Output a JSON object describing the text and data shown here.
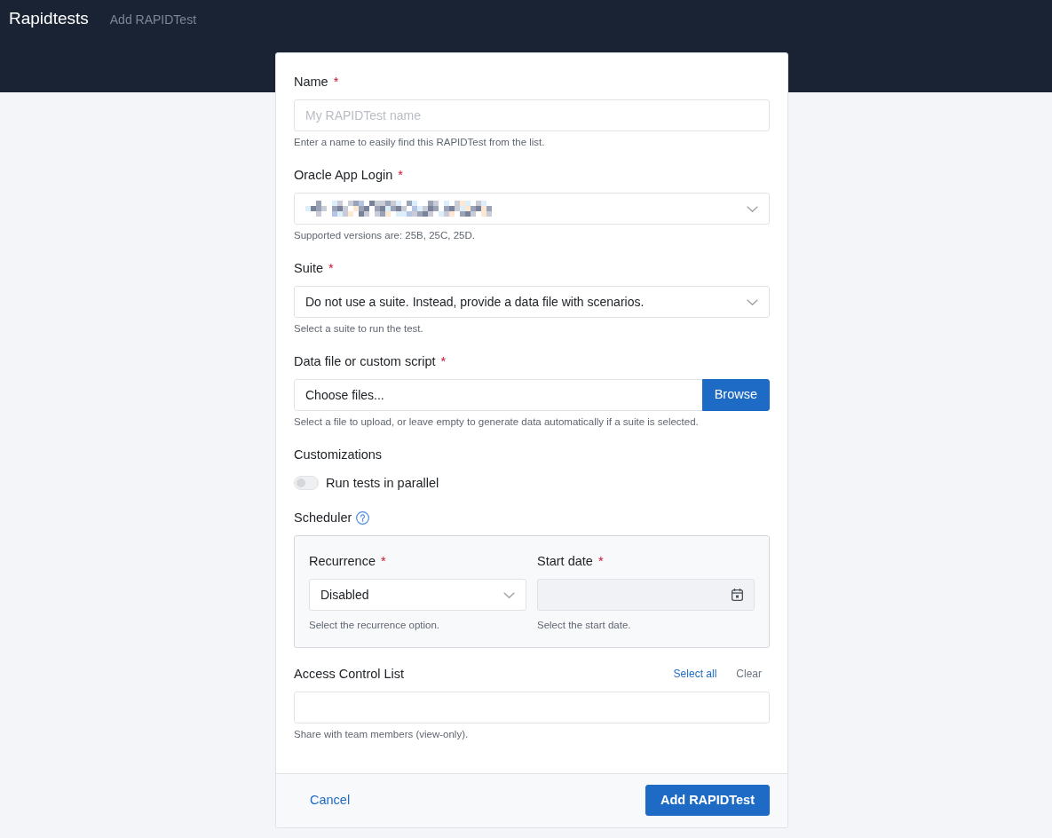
{
  "header": {
    "brand": "Rapidtests",
    "page_title": "Add RAPIDTest"
  },
  "form": {
    "fields": [
      {
        "kind": "text",
        "label": "Name",
        "mark": "*",
        "placeholder": "My RAPIDTest name",
        "help": "Enter a name to easily find this RAPIDTest from the list."
      },
      {
        "kind": "select",
        "label": "Oracle App Login",
        "mark": "*",
        "obscured": true,
        "help": "Supported versions are: 25B, 25C, 25D."
      },
      {
        "kind": "select",
        "label": "Suite",
        "mark": "*",
        "value": "Do not use a suite. Instead, provide a data file with scenarios.",
        "help": "Select a suite to run the test."
      },
      {
        "kind": "file",
        "label": "Data file or custom script",
        "mark": "*",
        "value": "Choose files...",
        "button": "Browse",
        "help": "Select a file to upload, or leave empty to generate data automatically if a suite is selected."
      },
      {
        "kind": "switches",
        "label": "Customizations",
        "switches": [
          {
            "label": "Run tests in parallel",
            "on": false
          }
        ]
      },
      {
        "kind": "scheduler",
        "label": "Scheduler",
        "help_icon": true,
        "columns": [
          {
            "kind": "select",
            "label": "Recurrence",
            "mark": "*",
            "value": "Disabled",
            "help": "Select the recurrence option."
          },
          {
            "kind": "date",
            "label": "Start date",
            "mark": "*",
            "disabled": true,
            "help": "Select the start date."
          }
        ]
      },
      {
        "kind": "multiselect",
        "label": "Access Control List",
        "actions": [
          {
            "label": "Select all",
            "kind": "primary"
          },
          {
            "label": "Clear",
            "kind": "muted"
          }
        ],
        "help": "Share with team members (view-only)."
      }
    ]
  },
  "footer": {
    "cancel": "Cancel",
    "submit": "Add RAPIDTest"
  }
}
